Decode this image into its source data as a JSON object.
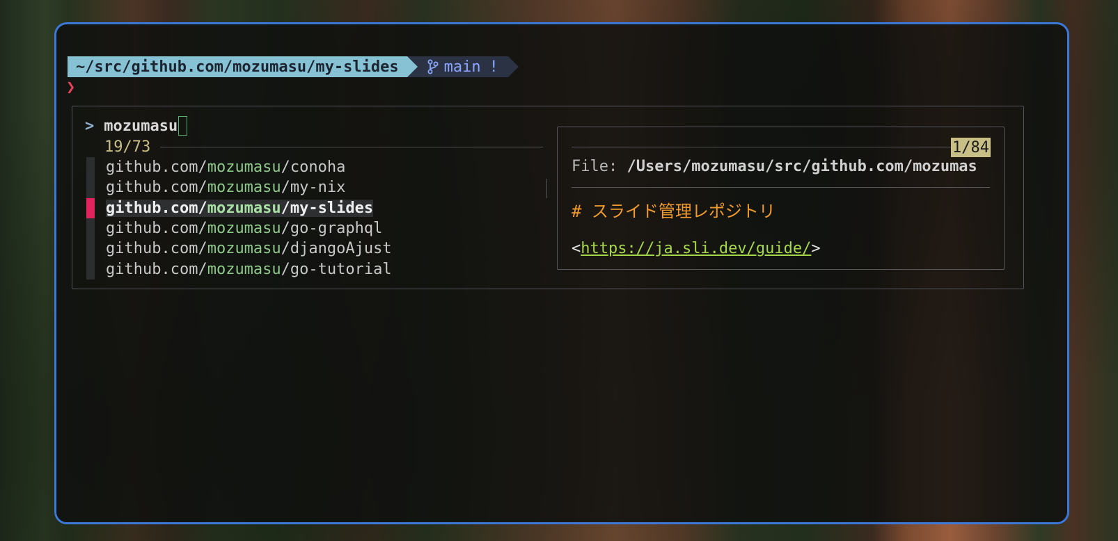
{
  "prompt": {
    "path": "~/src/github.com/mozumasu/my-slides",
    "git_branch": "main",
    "git_status": "!",
    "symbol": "❯"
  },
  "fzf": {
    "pointer": ">",
    "query": "mozumasu",
    "counter": "19/73",
    "items": [
      {
        "prefix": "github.com/",
        "match": "mozumasu",
        "suffix": "/conoha",
        "selected": false
      },
      {
        "prefix": "github.com/",
        "match": "mozumasu",
        "suffix": "/my-nix",
        "selected": false
      },
      {
        "prefix": "github.com/",
        "match": "mozumasu",
        "suffix": "/my-slides",
        "selected": true
      },
      {
        "prefix": "github.com/",
        "match": "mozumasu",
        "suffix": "/go-graphql",
        "selected": false
      },
      {
        "prefix": "github.com/",
        "match": "mozumasu",
        "suffix": "/djangoAjust",
        "selected": false
      },
      {
        "prefix": "github.com/",
        "match": "mozumasu",
        "suffix": "/go-tutorial",
        "selected": false
      }
    ]
  },
  "preview": {
    "position": "1/84",
    "file_label": "File: ",
    "file_path": "/Users/mozumasu/src/github.com/mozumas",
    "heading": "# スライド管理レポジトリ",
    "link_open": "<",
    "link_url": "https://ja.sli.dev/guide/",
    "link_close": ">"
  },
  "colors": {
    "window_border": "#3b78d8",
    "path_segment": "#86c1d4",
    "selected_marker": "#e0245e",
    "match_highlight": "#8fc98a",
    "heading": "#f09a2c",
    "link": "#a6d84a"
  }
}
